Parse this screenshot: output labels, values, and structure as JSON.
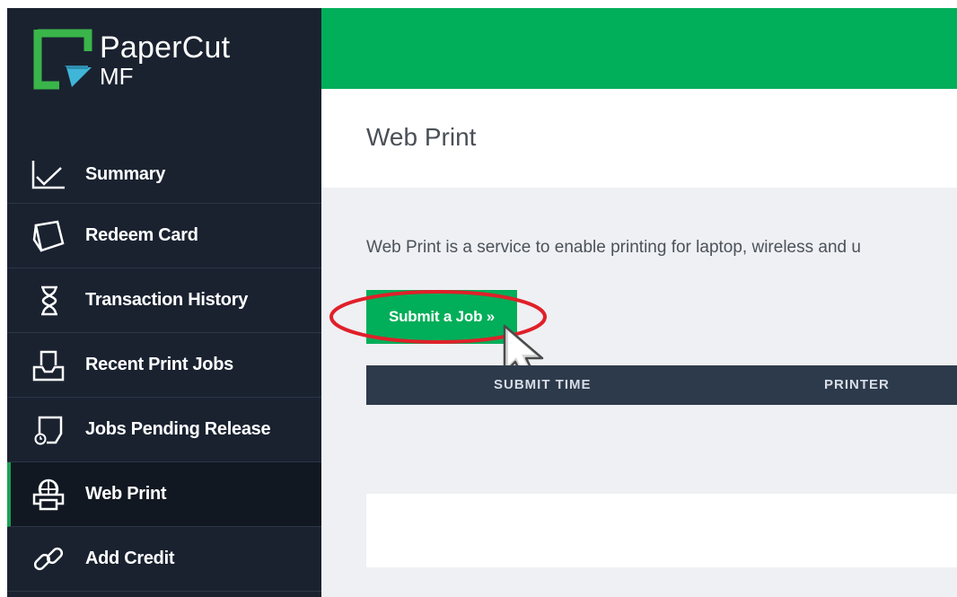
{
  "brand": {
    "name": "PaperCut",
    "trademark": "™",
    "product": "MF"
  },
  "nav": {
    "items": [
      {
        "label": "Summary",
        "icon": "chart-line-icon"
      },
      {
        "label": "Redeem Card",
        "icon": "card-icon"
      },
      {
        "label": "Transaction History",
        "icon": "hourglass-icon"
      },
      {
        "label": "Recent Print Jobs",
        "icon": "tray-icon"
      },
      {
        "label": "Jobs Pending Release",
        "icon": "pending-job-icon"
      },
      {
        "label": "Web Print",
        "icon": "globe-printer-icon",
        "active": true
      },
      {
        "label": "Add Credit",
        "icon": "link-icon"
      }
    ]
  },
  "page": {
    "title": "Web Print",
    "description": "Web Print is a service to enable printing for laptop, wireless and u"
  },
  "actions": {
    "submit_label": "Submit a Job »"
  },
  "table": {
    "columns": [
      "SUBMIT TIME",
      "PRINTER"
    ]
  },
  "colors": {
    "accent": "#01ae59",
    "sidebar": "#1a2230",
    "table_header": "#2d3a4b",
    "highlight": "#e0202a"
  }
}
